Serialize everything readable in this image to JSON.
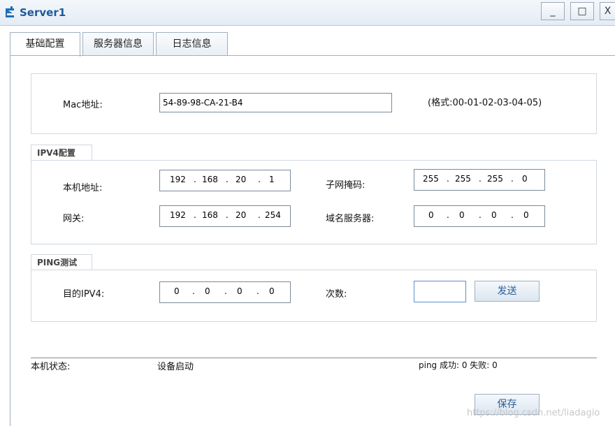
{
  "window": {
    "title": "Server1",
    "controls": [
      "_",
      "□",
      "X"
    ]
  },
  "tabs": [
    {
      "label": "基础配置",
      "active": true
    },
    {
      "label": "服务器信息",
      "active": false
    },
    {
      "label": "日志信息",
      "active": false
    }
  ],
  "mac": {
    "label": "Mac地址:",
    "value": "54-89-98-CA-21-B4",
    "hint": "(格式:00-01-02-03-04-05)"
  },
  "ipv4": {
    "section_label": "IPV4配置",
    "local_address": {
      "label": "本机地址:",
      "octets": [
        "192",
        "168",
        "20",
        "1"
      ]
    },
    "subnet_mask": {
      "label": "子网掩码:",
      "octets": [
        "255",
        "255",
        "255",
        "0"
      ]
    },
    "gateway": {
      "label": "网关:",
      "octets": [
        "192",
        "168",
        "20",
        "254"
      ]
    },
    "dns_server": {
      "label": "域名服务器:",
      "octets": [
        "0",
        "0",
        "0",
        "0"
      ]
    }
  },
  "ping": {
    "section_label": "PING测试",
    "dest_label": "目的IPV4:",
    "dest_octets": [
      "0",
      "0",
      "0",
      "0"
    ],
    "count_label": "次数:",
    "count_value": "",
    "send_label": "发送"
  },
  "status": {
    "label": "本机状态:",
    "value": "设备启动",
    "ping_result": "ping 成功: 0 失败: 0"
  },
  "save_label": "保存",
  "watermark": "https://blog.csdn.net/liadagio"
}
